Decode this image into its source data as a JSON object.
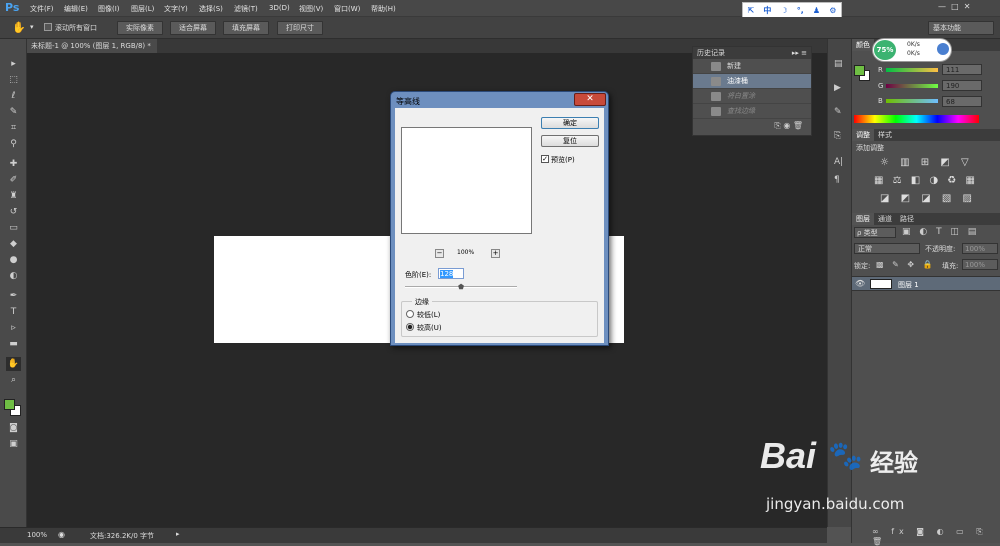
{
  "app": {
    "logo": "Ps"
  },
  "menu": [
    "文件(F)",
    "编辑(E)",
    "图像(I)",
    "图层(L)",
    "文字(Y)",
    "选择(S)",
    "滤镜(T)",
    "3D(D)",
    "视图(V)",
    "窗口(W)",
    "帮助(H)"
  ],
  "ime": {
    "label": "中"
  },
  "options": {
    "scroll_all": "滚动所有窗口",
    "buttons": [
      "实际像素",
      "适合屏幕",
      "填充屏幕",
      "打印尺寸"
    ],
    "workspace": "基本功能"
  },
  "document": {
    "tab": "未标题-1 @ 100% (图层 1, RGB/8) *"
  },
  "status": {
    "zoom": "100%",
    "doc": "文档:326.2K/0 字节"
  },
  "history": {
    "title": "历史记录",
    "items": [
      "新建",
      "油漆桶",
      "将白置涂",
      "查找边缘"
    ]
  },
  "net": {
    "percent": "75%",
    "up": "0K/s",
    "down": "0K/s"
  },
  "color_panel": {
    "tabs": [
      "颜色",
      "色板"
    ],
    "r_label": "R",
    "r_value": "111",
    "g_label": "G",
    "g_value": "190",
    "b_label": "B",
    "b_value": "68",
    "fg_color": "#6fbe44",
    "bg_color": "#ffffff"
  },
  "adjust": {
    "tabs": [
      "调整",
      "样式"
    ],
    "title": "添加调整"
  },
  "layers": {
    "tabs": [
      "图层",
      "通道",
      "路径"
    ],
    "kind": "ρ 类型",
    "blend": "正常",
    "opacity_label": "不透明度:",
    "opacity": "100%",
    "lock_label": "锁定:",
    "fill_label": "填充:",
    "fill": "100%",
    "layer_name": "图层 1"
  },
  "dialog": {
    "title": "等高线",
    "ok": "确定",
    "reset": "复位",
    "preview": "预览(P)",
    "zoom": "100%",
    "zoom_minus": "−",
    "zoom_plus": "+",
    "level_label": "色阶(E):",
    "level_value": "128",
    "edge_group": "边缘",
    "lower": "较低(L)",
    "upper": "较高(U)",
    "selected_edge": "upper",
    "preview_checked": true,
    "slider_fraction": 0.5
  },
  "watermark": {
    "brand": "Bai",
    "brand2": "经验",
    "url": "jingyan.baidu.com"
  }
}
